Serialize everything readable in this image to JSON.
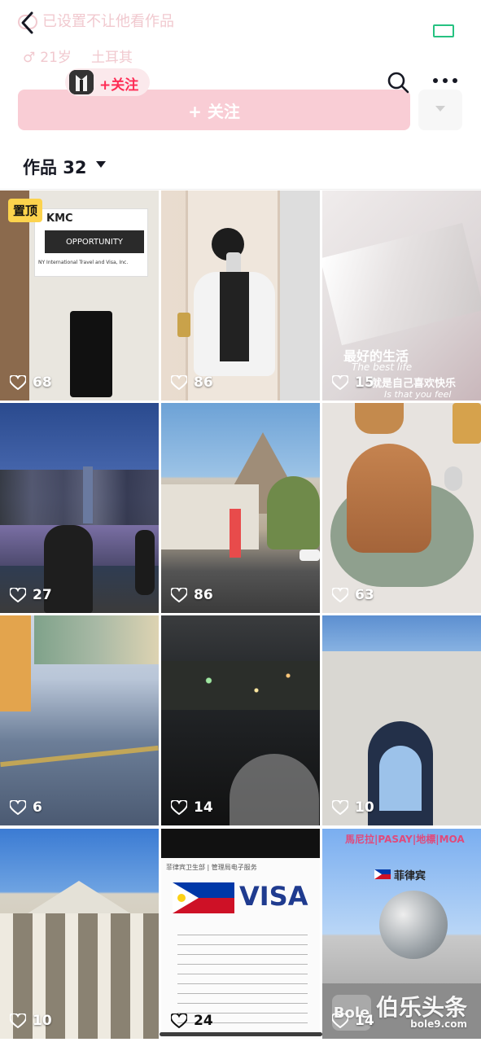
{
  "ghost_header": {
    "blocked_text": "已设置不让他看作品",
    "age_text": "21岁",
    "location_text": "土耳其"
  },
  "topbar": {
    "follow_mini_label": "+关注"
  },
  "follow_button_label": "+ 关注",
  "works_tab": {
    "label": "作品 32"
  },
  "grid": [
    {
      "likes": "68",
      "pinned": "置顶",
      "sign_company": "KMC",
      "sign_text": "OPPORTUNITY",
      "sign_sub": "NY International Travel and Visa, Inc."
    },
    {
      "likes": "86"
    },
    {
      "likes": "15",
      "line1": "最好的生活",
      "line2": "The best life",
      "line3": "就是自己喜欢快乐",
      "line4": "Is that you feel happy"
    },
    {
      "likes": "27"
    },
    {
      "likes": "86"
    },
    {
      "likes": "63"
    },
    {
      "likes": "6"
    },
    {
      "likes": "14"
    },
    {
      "likes": "10"
    },
    {
      "likes": "10"
    },
    {
      "likes": "24",
      "visa_text": "VISA",
      "doc_header": "菲律宾卫生部 | 管理局电子服务"
    },
    {
      "likes": "14",
      "banner_text": "馬尼拉|PASAY|地標|MOA",
      "flag_label": "菲律宾"
    }
  ],
  "watermark": {
    "logo_text": "Bole",
    "name": "伯乐头条",
    "domain": "bole9.com"
  },
  "colors": {
    "accent": "#fe2c55",
    "follow_bg": "#f9cdd5",
    "pinned": "#fcd34d"
  }
}
